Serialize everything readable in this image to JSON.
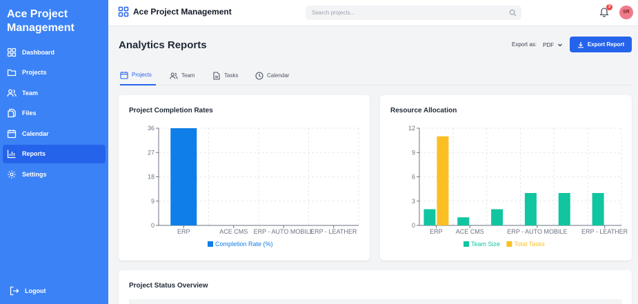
{
  "sidebar": {
    "brand": "Ace Project Management",
    "items": [
      {
        "label": "Dashboard",
        "icon": "dashboard-grid-icon"
      },
      {
        "label": "Projects",
        "icon": "folder-icon"
      },
      {
        "label": "Team",
        "icon": "users-icon"
      },
      {
        "label": "Files",
        "icon": "files-icon"
      },
      {
        "label": "Calendar",
        "icon": "calendar-icon"
      },
      {
        "label": "Reports",
        "icon": "bar-chart-icon",
        "active": true
      },
      {
        "label": "Settings",
        "icon": "gear-icon"
      }
    ],
    "logout": "Logout"
  },
  "topbar": {
    "title": "Ace Project Management",
    "search_placeholder": "Search projects...",
    "notification_count": "3",
    "avatar_initials": "SR"
  },
  "main": {
    "title": "Analytics Reports",
    "export_label": "Export as:",
    "export_format": "PDF",
    "export_button": "Export Report",
    "tabs": [
      {
        "label": "Projects",
        "active": true
      },
      {
        "label": "Team"
      },
      {
        "label": "Tasks"
      },
      {
        "label": "Calendar"
      }
    ]
  },
  "cards": {
    "completion_title": "Project Completion Rates",
    "resource_title": "Resource Allocation",
    "status_title": "Project Status Overview"
  },
  "colors": {
    "sidebar": "#3b82f6",
    "accent": "#2563eb",
    "completion": "#0f7ee8",
    "team_size": "#10c5a0",
    "total_tasks": "#fbbf24"
  },
  "chart_data": [
    {
      "type": "bar",
      "title": "Project Completion Rates",
      "categories": [
        "ERP",
        "ACE CMS",
        "ERP - AUTO MOBILE",
        "ERP - LEATHER"
      ],
      "series": [
        {
          "name": "Completion Rate (%)",
          "values": [
            36,
            0,
            0,
            0
          ]
        }
      ],
      "yticks": [
        0,
        9,
        18,
        27,
        36
      ],
      "ylim": [
        0,
        36
      ],
      "grid": true,
      "legend": "bottom"
    },
    {
      "type": "bar",
      "title": "Resource Allocation",
      "categories": [
        "ERP",
        "ACE CMS",
        "",
        "ERP - AUTO MOBILE",
        "",
        "ERP - LEATHER"
      ],
      "series": [
        {
          "name": "Team Size",
          "values": [
            2,
            1,
            2,
            4,
            4,
            4
          ]
        },
        {
          "name": "Total Tasks",
          "values": [
            11,
            0,
            0,
            0,
            0,
            0
          ]
        }
      ],
      "yticks": [
        0,
        3,
        6,
        9,
        12
      ],
      "ylim": [
        0,
        12
      ],
      "grid": true,
      "legend": "bottom"
    }
  ]
}
